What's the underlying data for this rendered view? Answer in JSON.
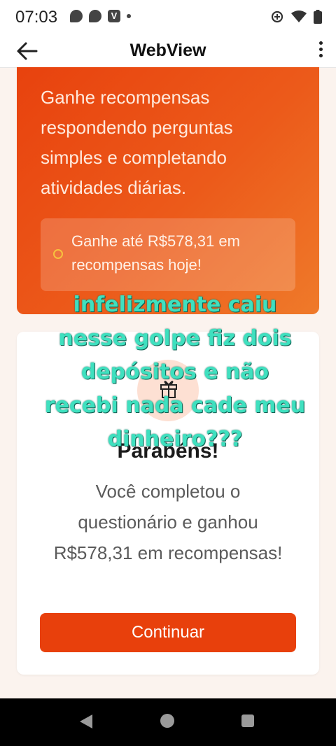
{
  "status_bar": {
    "time": "07:03",
    "notification_icons": [
      "chat-bubble-icon",
      "messenger-icon",
      "v-app-icon",
      "dot-icon"
    ],
    "system_icons": [
      "data-saver-icon",
      "wifi-icon",
      "battery-icon"
    ],
    "v_glyph": "V"
  },
  "app_bar": {
    "title": "WebView",
    "back_icon": "back-arrow-icon",
    "menu_icon": "overflow-menu-icon"
  },
  "hero": {
    "text": "Ganhe recompensas respondendo perguntas simples e completando atividades diárias.",
    "reward_text": "Ganhe até R$578,31 em recompensas hoje!",
    "coin_icon": "coin-icon",
    "gradient_start": "#e8420e",
    "gradient_end": "#ef7a2a"
  },
  "card": {
    "title": "Parabéns!",
    "body": "Você completou o questionário e ganhou R$578,31 em recompensas!",
    "button_label": "Continuar",
    "button_color": "#e8400c",
    "gift_icon": "gift-icon"
  },
  "overlay_caption": "infelizmente caiu nesse golpe fiz dois depósitos e não recebi nada cade meu dinheiro???",
  "overlay_color": "#3fe0bf",
  "nav_bar": [
    "back-triangle-icon",
    "home-circle-icon",
    "recents-square-icon"
  ]
}
